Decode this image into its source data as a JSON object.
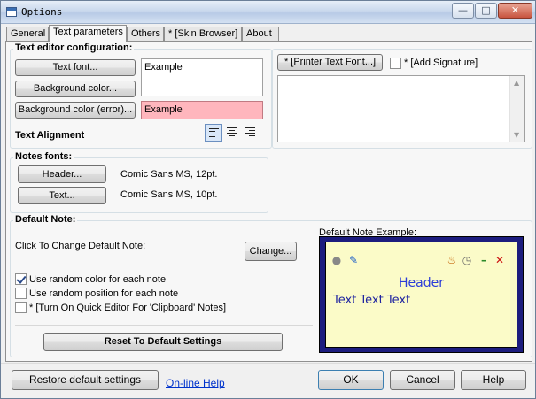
{
  "window": {
    "title": "Options"
  },
  "title_buttons": {
    "minimize": "—",
    "maximize": "□",
    "close": "✕"
  },
  "tabs": [
    "General",
    "Text parameters",
    "Others",
    "* [Skin Browser]",
    "About"
  ],
  "text_editor": {
    "label": "Text editor configuration:",
    "text_font_button": "Text font...",
    "background_color_button": "Background color...",
    "background_error_button": "Background color (error)...",
    "example_text": "Example",
    "example_error_text": "Example",
    "alignment_label": "Text Alignment"
  },
  "printer": {
    "printer_font_button": "* [Printer Text Font...]",
    "add_signature_label": "* [Add Signature]"
  },
  "notes_fonts": {
    "label": "Notes fonts:",
    "header_button": "Header...",
    "header_font": "Comic Sans MS,  12pt.",
    "text_button": "Text...",
    "text_font": "Comic Sans MS,  10pt."
  },
  "default_note": {
    "label": "Default Note:",
    "click_to_change": "Click To Change Default Note:",
    "change_button": "Change...",
    "example_label": "Default Note Example:",
    "options": [
      {
        "label": "Use random color for each note",
        "checked": true
      },
      {
        "label": "Use random position for each note",
        "checked": false
      },
      {
        "label": "* [Turn On Quick Editor For 'Clipboard' Notes]",
        "checked": false
      }
    ],
    "reset_button": "Reset To Default Settings",
    "preview": {
      "header": "Header",
      "text": "Text Text Text"
    }
  },
  "footer": {
    "restore_button": "Restore default settings",
    "online_help_link": "On-line Help",
    "ok_button": "OK",
    "cancel_button": "Cancel",
    "help_button": "Help"
  },
  "colors": {
    "error_background": "#ffb6bd",
    "preview_border": "#1c1c7e",
    "preview_background": "#fbfbc8",
    "preview_header": "#2b3cd8"
  }
}
